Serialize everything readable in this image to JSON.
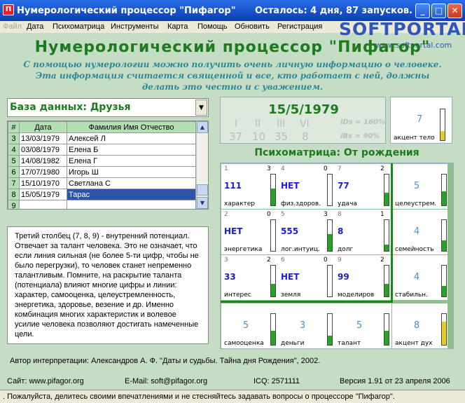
{
  "window": {
    "title": "Нумерологический процессор \"Пифагор\"",
    "remaining": "Осталось: 4 дня, 87 запусков.",
    "minimize": "_",
    "maximize": "□",
    "close": "✕"
  },
  "menu": [
    "Файл",
    "Дата",
    "Психоматрица",
    "Инструменты",
    "Карта",
    "Помощь",
    "Обновить",
    "Регистрация"
  ],
  "watermark": {
    "brand": "SOFTPORTAL",
    "url": "www.softportal.com"
  },
  "heading": "Нумерологический процессор \"Пифагор\"",
  "intro": [
    "С помощью нумерологии можно получить очень личную информацию о человеке.",
    "Эта информация считается священной и все, кто работает с ней, должны",
    "делать это честно и с уважением."
  ],
  "database": {
    "label": "База данных: Друзья"
  },
  "table": {
    "headers": [
      "#",
      "Дата",
      "Фамилия Имя Отчество"
    ],
    "rows": [
      {
        "n": "3",
        "date": "13/03/1979",
        "name": "Алексей Л"
      },
      {
        "n": "4",
        "date": "03/08/1979",
        "name": "Елена Б"
      },
      {
        "n": "5",
        "date": "14/08/1982",
        "name": "Елена Г"
      },
      {
        "n": "6",
        "date": "17/07/1980",
        "name": "Игорь Ш"
      },
      {
        "n": "7",
        "date": "15/10/1970",
        "name": "Светлана С"
      },
      {
        "n": "8",
        "date": "15/05/1979",
        "name": "Тарас"
      },
      {
        "n": "9",
        "date": "",
        "name": ""
      }
    ]
  },
  "info_text": "Третий столбец (7, 8, 9) - внутренний потенциал. Отвечает за талант человека. Это не означает, что если линия сильная (не более 5-ти цифр, чтобы не было перегрузки), то человек станет непременно талантливым. Помните, на раскрытие таланта (потенциала) влияют многие цифры и линии: характер, самооценка, целеустремленность, энергетика, здоровье, везение и др. Именно комбинация многих характеристик и волевое усилие человека позволяют достигать намеченные цели.",
  "author": "Автор интерпретации: Александров А. Ф. \"Даты и судьбы. Тайна дня Рождения\", 2002.",
  "date_panel": {
    "date": "15/5/1979",
    "roman": [
      "I",
      "II",
      "III",
      "VI"
    ],
    "numbers": [
      "37",
      "10",
      "35",
      "8"
    ],
    "ids": "iDs = 160%",
    "ibs": "iBs = 90%"
  },
  "accent_body": {
    "value": "7",
    "label": "акцент тело",
    "level": 0.3
  },
  "psychomatrix": {
    "title": "Психоматрица: От рождения",
    "cells": [
      {
        "left": "1",
        "right": "3",
        "value": "111",
        "label": "характер",
        "level": 0.55
      },
      {
        "left": "4",
        "right": "0",
        "value": "НЕТ",
        "label": "физ.здоров.",
        "level": 0.0
      },
      {
        "left": "7",
        "right": "2",
        "value": "77",
        "label": "удача",
        "level": 0.4
      },
      {
        "left": "",
        "right": "",
        "value": "5",
        "label": "целеустрем.",
        "level": 0.45
      },
      {
        "left": "2",
        "right": "0",
        "value": "НЕТ",
        "label": "энергетика",
        "level": 0.0
      },
      {
        "left": "5",
        "right": "3",
        "value": "555",
        "label": "лог.интуиц.",
        "level": 0.55
      },
      {
        "left": "8",
        "right": "1",
        "value": "8",
        "label": "долг",
        "level": 0.2
      },
      {
        "left": "",
        "right": "",
        "value": "4",
        "label": "семейность",
        "level": 0.35
      },
      {
        "left": "3",
        "right": "2",
        "value": "33",
        "label": "интерес",
        "level": 0.4
      },
      {
        "left": "6",
        "right": "0",
        "value": "НЕТ",
        "label": "земля",
        "level": 0.0
      },
      {
        "left": "9",
        "right": "2",
        "value": "99",
        "label": "моделиров",
        "level": 0.4
      },
      {
        "left": "",
        "right": "",
        "value": "4",
        "label": "стабильн.",
        "level": 0.35
      },
      {
        "left": "",
        "right": "",
        "value": "5",
        "label": "самооценка",
        "level": 0.45
      },
      {
        "left": "",
        "right": "",
        "value": "3",
        "label": "деньги",
        "level": 0.3
      },
      {
        "left": "",
        "right": "",
        "value": "5",
        "label": "талант",
        "level": 0.45
      },
      {
        "left": "",
        "right": "",
        "value": "8",
        "label": "акцент дух",
        "level": 0.75
      }
    ]
  },
  "footer": {
    "site": "Сайт:  www.pifagor.org",
    "email": "E-Mail: soft@pifagor.org",
    "icq": "ICQ: 2571111",
    "version": "Версия 1.91 от 23 апреля 2006"
  },
  "status": ". Пожалуйста, делитесь своими впечатлениями и не стесняйтесь задавать вопросы о процессоре \"Пифагор\"."
}
